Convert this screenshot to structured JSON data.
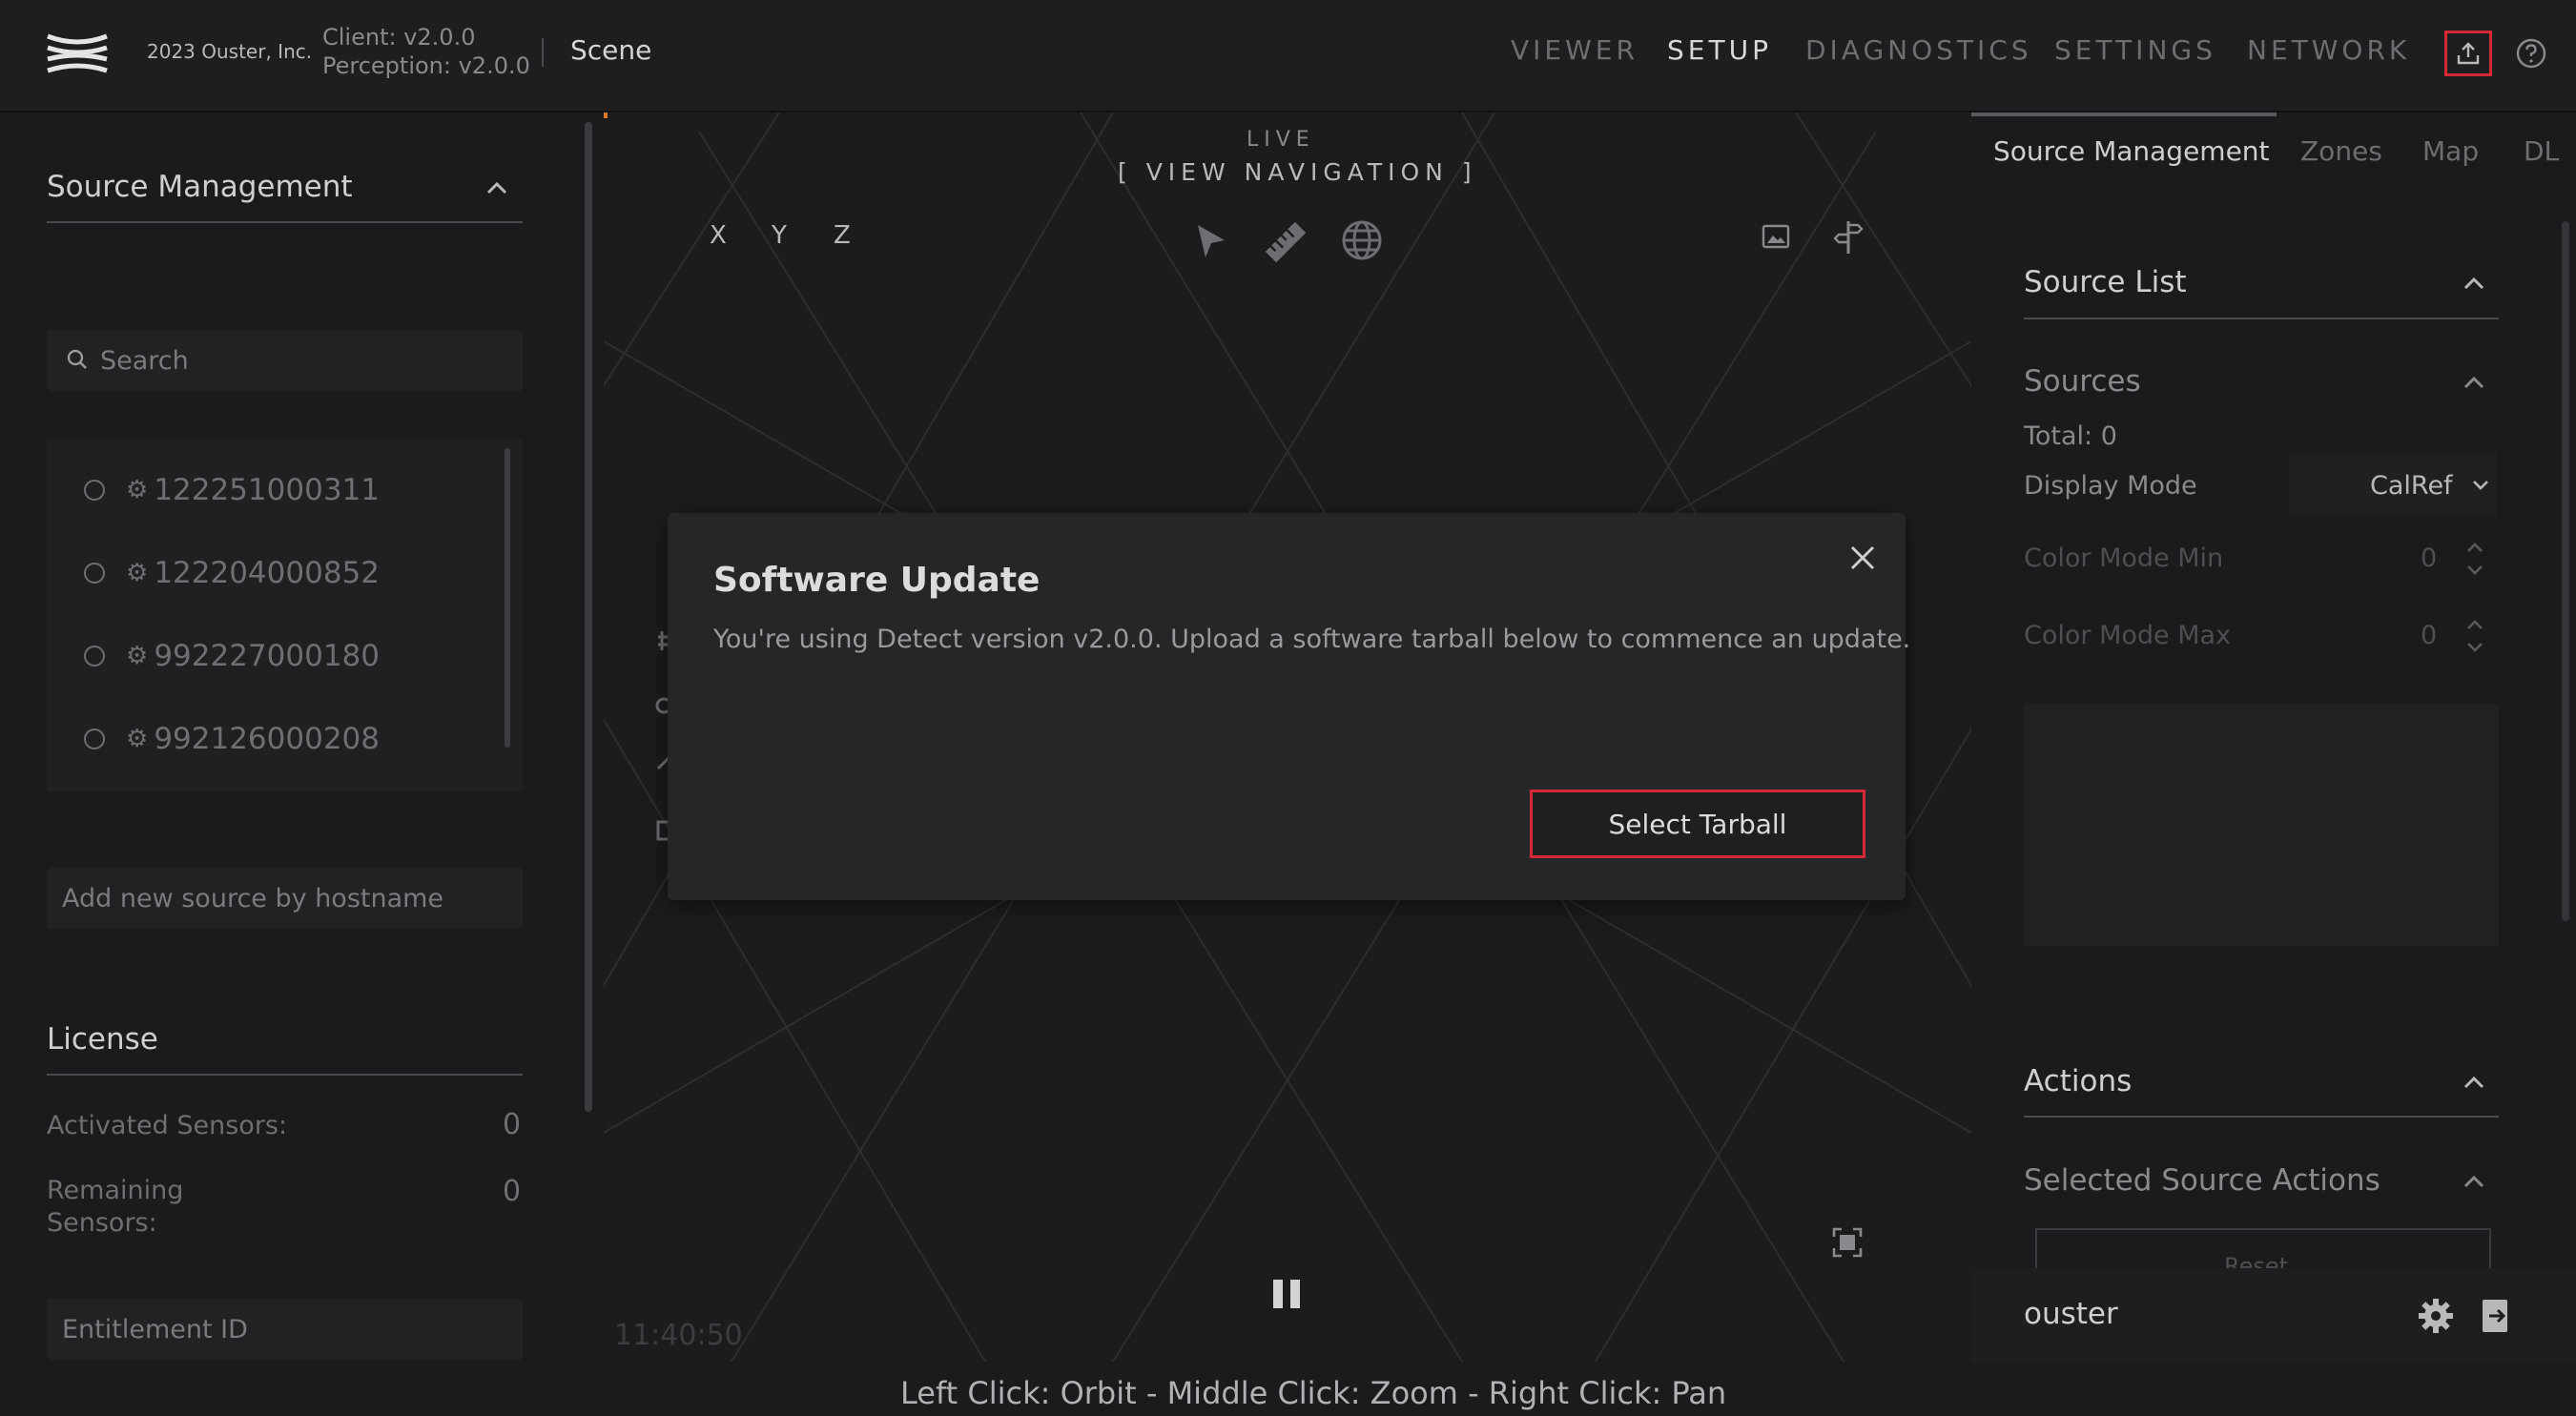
{
  "header": {
    "copyright": "2023 Ouster, Inc.",
    "client_version": "Client: v2.0.0",
    "perception_version": "Perception: v2.0.0",
    "scene_label": "Scene",
    "nav": [
      "VIEWER",
      "SETUP",
      "DIAGNOSTICS",
      "SETTINGS",
      "NETWORK"
    ],
    "active_nav": "SETUP"
  },
  "left": {
    "source_management_title": "Source Management",
    "search_placeholder": "Search",
    "sources": [
      "122251000311",
      "122204000852",
      "992227000180",
      "992126000208"
    ],
    "hostname_placeholder": "Add new source by hostname",
    "license_title": "License",
    "activated_label": "Activated Sensors:",
    "activated_value": "0",
    "remaining_label_1": "Remaining",
    "remaining_label_2": "Sensors:",
    "remaining_value": "0",
    "entitlement_placeholder": "Entitlement ID"
  },
  "viewer": {
    "live": "LIVE",
    "view_navigation": "[ VIEW NAVIGATION ]",
    "axes": [
      "X",
      "Y",
      "Z"
    ],
    "timestamp": "11:40:50",
    "help_text": "Left Click: Orbit - Middle Click: Zoom - Right Click: Pan"
  },
  "right": {
    "tabs": [
      "Source Management",
      "Zones",
      "Map",
      "DL"
    ],
    "source_list_title": "Source List",
    "sources_title": "Sources",
    "total": "Total: 0",
    "display_mode_label": "Display Mode",
    "display_mode_value": "CalRef",
    "color_min_label": "Color Mode Min",
    "color_min_value": "0",
    "color_max_label": "Color Mode Max",
    "color_max_value": "0",
    "actions_title": "Actions",
    "selected_actions_title": "Selected Source Actions",
    "reset_label": "Reset",
    "username": "ouster"
  },
  "modal": {
    "title": "Software Update",
    "message": "You're using Detect version v2.0.0. Upload a software tarball below to commence an update.",
    "button": "Select Tarball"
  },
  "colors": {
    "accent_red": "#d52a34",
    "background": "#1b1b1d",
    "modal_bg": "#262629"
  },
  "icons": [
    "ouster-logo-icon",
    "upload-icon",
    "help-icon",
    "search-icon",
    "radio-icon",
    "sensor-icon",
    "chevron-up-icon",
    "chevron-down-icon",
    "pointer-icon",
    "ruler-icon",
    "globe-icon",
    "image-icon",
    "signpost-icon",
    "fullscreen-icon",
    "pause-icon",
    "gear-icon",
    "logout-icon",
    "close-icon"
  ]
}
